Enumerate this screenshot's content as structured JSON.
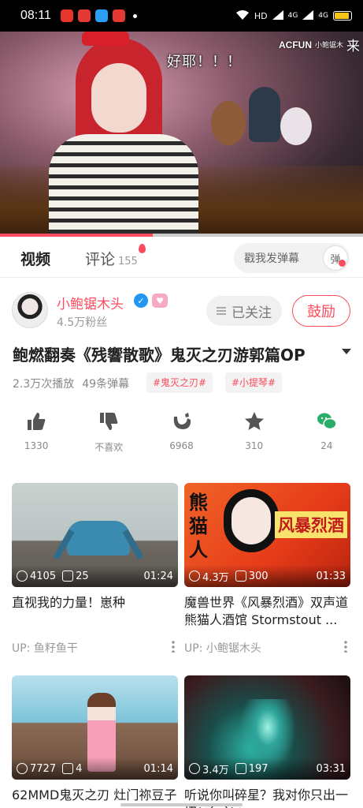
{
  "status_bar": {
    "time": "08:11",
    "network": "HD",
    "signal1": "4G",
    "signal2": "4G",
    "battery_fraction": 0.9
  },
  "video": {
    "danmaku": "好耶！！！",
    "watermark_logo": "ACFUN",
    "watermark_name": "小鲍锯木",
    "watermark_more": "来",
    "progress_fraction": 0.42
  },
  "tabs": {
    "video": "视频",
    "comments": "评论",
    "comment_count": "155",
    "danmaku_placeholder": "戳我发弹幕",
    "danmaku_toggle": "弹"
  },
  "uploader": {
    "name": "小鲍锯木头",
    "fans": "4.5万粉丝",
    "followed_label": "已关注",
    "cheer_label": "鼓励"
  },
  "title": "鲍燃翻奏《残響散歌》鬼灭之刃游郭篇OP",
  "stats": {
    "plays": "2.3万次播放",
    "danmaku": "49条弹幕"
  },
  "tags": [
    "#鬼灭之刃#",
    "#小提琴#"
  ],
  "actions": [
    {
      "icon": "thumbs-up-icon",
      "label": "1330"
    },
    {
      "icon": "thumbs-down-icon",
      "label": "不喜欢"
    },
    {
      "icon": "banana-icon",
      "label": "6968"
    },
    {
      "icon": "star-icon",
      "label": "310"
    },
    {
      "icon": "wechat-icon",
      "label": "24"
    }
  ],
  "videos": [
    {
      "plays": "4105",
      "danmaku": "25",
      "duration": "01:24",
      "title": "直视我的力量！崽种",
      "up": "UP: 鱼籽鱼干"
    },
    {
      "plays": "4.3万",
      "danmaku": "300",
      "duration": "01:33",
      "title": "魔兽世界《风暴烈酒》双声道 熊猫人酒馆 Stormstout ...",
      "up": "UP: 小鲍锯木头",
      "thumb_text_left": "熊猫人",
      "thumb_text_right": "风暴烈酒"
    },
    {
      "plays": "7727",
      "danmaku": "4",
      "duration": "01:14",
      "title": "62MMD鬼灭之刃 灶门祢豆子",
      "up": ""
    },
    {
      "plays": "3.4万",
      "danmaku": "197",
      "duration": "03:31",
      "title": "听说你叫碎星？我对你只出一招(ﾉ´▽`)ﾉ",
      "up": ""
    }
  ],
  "colors": {
    "accent": "#fd4c5d",
    "wechat": "#2aae67"
  }
}
